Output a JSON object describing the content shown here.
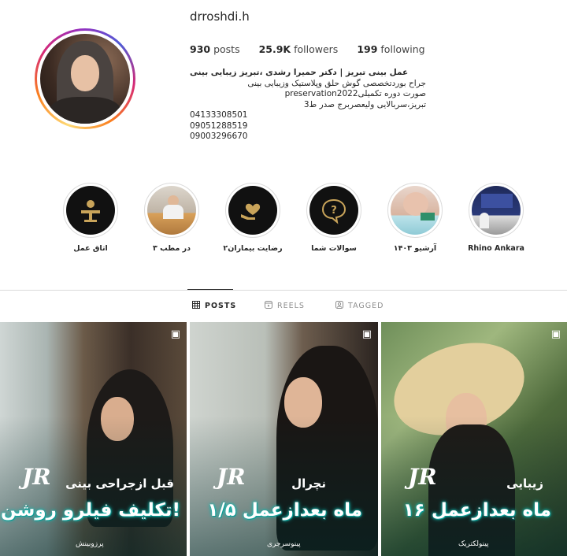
{
  "profile": {
    "username": "drroshdi.h",
    "stats": {
      "posts_count": "930",
      "posts_label": "posts",
      "followers_count": "25.9K",
      "followers_label": "followers",
      "following_count": "199",
      "following_label": "following"
    },
    "bio": {
      "name": "عمل بینی تبریز | دکتر حمیرا رشدی ،تبریز زیبایی بینی",
      "lines": [
        "جراح بوردتخصصی گوش حلق وپلاستیک وزیبایی بینی",
        "صورت دوره تکمیلیpreservation2022",
        "تبریز،سربالایی ولیعصربرج صدر ط3",
        "04133308501",
        "09051288519",
        "09003296670"
      ]
    }
  },
  "highlights": [
    {
      "label": "اتاق عمل",
      "icon": "surgery-table-icon"
    },
    {
      "label": "در مطب ۳",
      "icon": "clinic-photo"
    },
    {
      "label": "رضایت بیماران۲",
      "icon": "heart-hands-icon"
    },
    {
      "label": "سوالات شما",
      "icon": "question-bubble-icon"
    },
    {
      "label": "آرشیو ۱۴۰۳",
      "icon": "archive-photo"
    },
    {
      "label": "Rhino Ankara",
      "icon": "conference-photo"
    }
  ],
  "tabs": [
    {
      "label": "POSTS",
      "icon": "grid-icon",
      "active": true
    },
    {
      "label": "REELS",
      "icon": "reels-icon",
      "active": false
    },
    {
      "label": "TAGGED",
      "icon": "tagged-icon",
      "active": false
    }
  ],
  "posts": [
    {
      "caption_small": "قبل ازجراحی بینی",
      "caption_big": "تکلیف فیلرو روشن کن!",
      "footer": "پرزوبینش",
      "icon": "reel-icon"
    },
    {
      "caption_small": "نچرال",
      "caption_big": "۱/۵ ماه بعدازعمل",
      "footer": "پینوسرجری",
      "icon": "reel-icon"
    },
    {
      "caption_small": "زیبایی",
      "caption_big": "۱۶ ماه بعدازعمل",
      "footer": "پینولکتریک",
      "icon": "reel-icon"
    }
  ],
  "colors": {
    "text": "#262626",
    "muted": "#8e8e8e",
    "divider": "#dbdbdb",
    "caption_glow": "#0fb8b0"
  }
}
